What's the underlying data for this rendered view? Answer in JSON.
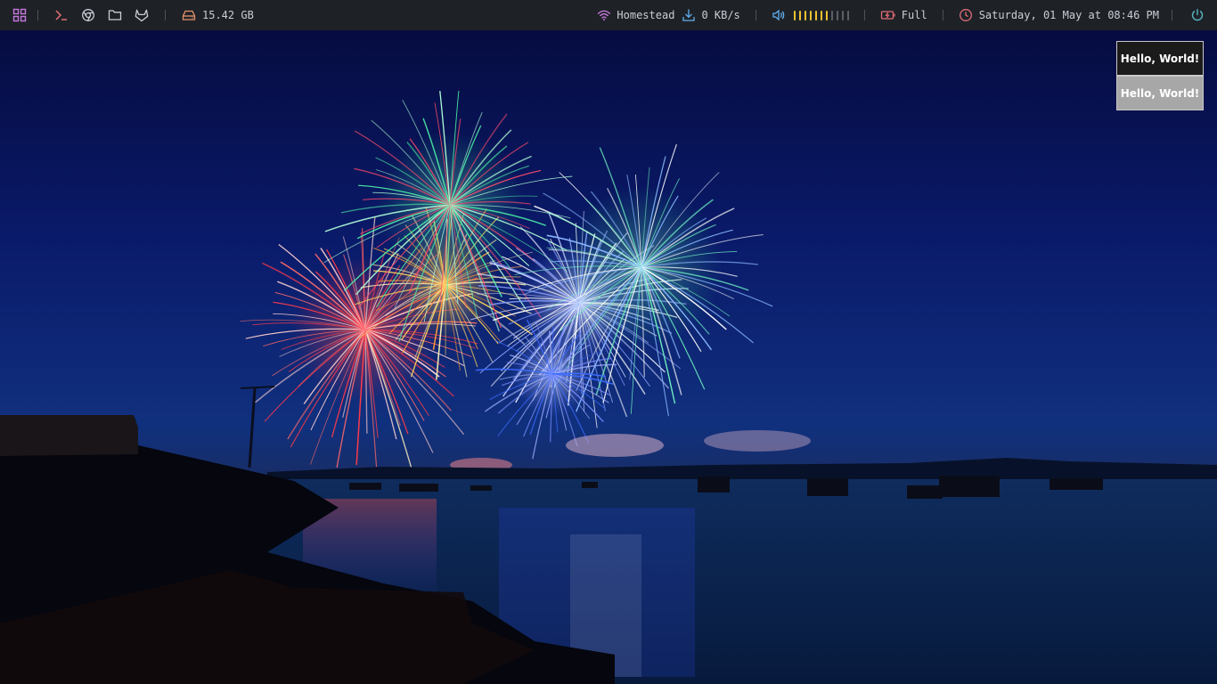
{
  "bar": {
    "left": {
      "icons": [
        "apps-grid-icon",
        "terminal-icon",
        "browser-icon",
        "folder-icon",
        "gitlab-icon",
        "disk-icon"
      ],
      "disk_free": "15.42 GB"
    },
    "network": {
      "ssid": "Homestead",
      "download_rate": "0 KB/s"
    },
    "volume": {
      "level": 0.65,
      "segments": 11,
      "active_color": "#f1c232",
      "inactive_color": "#5b6068"
    },
    "battery": {
      "status": "Full"
    },
    "clock": {
      "datetime": "Saturday, 01 May at 08:46 PM"
    },
    "colors": {
      "apps": "#c678dd",
      "terminal": "#e06c75",
      "neutral": "#c9ced6",
      "disk": "#e5936b",
      "wifi": "#c678dd",
      "download": "#61afef",
      "volume": "#61afef",
      "battery": "#e06c75",
      "clock": "#e06c75",
      "power": "#56b6c2"
    }
  },
  "notifications": [
    {
      "text": "Hello, World!",
      "style": "dark"
    },
    {
      "text": "Hello, World!",
      "style": "light"
    }
  ],
  "wallpaper": {
    "subject": "fireworks over a harbor at night"
  }
}
